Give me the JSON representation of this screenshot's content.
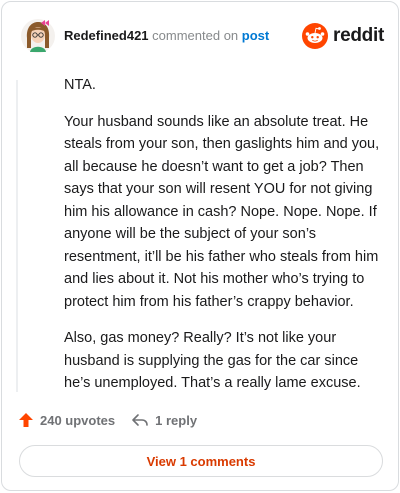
{
  "header": {
    "username": "Redefined421",
    "action_text": "commented on",
    "post_link": "post",
    "brand": "reddit"
  },
  "comment": {
    "paragraphs": [
      "NTA.",
      "Your husband sounds like an absolute treat. He steals from your son, then gaslights him and you, all because he doesn’t want to get a job? Then says that your son will resent YOU for not giving him his allowance in cash? Nope. Nope. Nope. If anyone will be the subject of your son’s resentment, it’ll be his father who steals from him and lies about it. Not his mother who’s trying to protect him from his father’s crappy behavior.",
      "Also, gas money? Really? It’s not like your husband is supplying the gas for the car since he’s unemployed. That’s a really lame excuse."
    ]
  },
  "actions": {
    "upvotes_label": "240 upvotes",
    "reply_label": "1 reply",
    "view_comments_label": "View 1 comments"
  },
  "colors": {
    "accent": "#ff4500",
    "link": "#0079d3",
    "view_button_text": "#d93a00"
  },
  "icons": {
    "upvote": "arrow-up-icon",
    "reply": "reply-arrow-icon",
    "brand": "reddit-snoo-icon",
    "avatar": "user-avatar"
  }
}
